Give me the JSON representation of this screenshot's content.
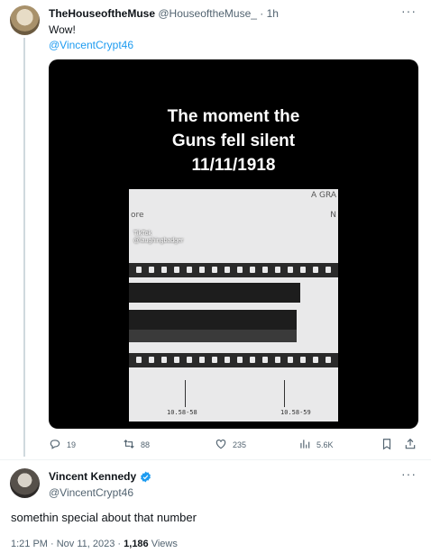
{
  "reply": {
    "display_name": "TheHouseoftheMuse",
    "handle": "@HouseoftheMuse_",
    "time": "· 1h",
    "text": "Wow!",
    "mention": "@VincentCrypt46",
    "media": {
      "caption_line1": "The moment the",
      "caption_line2": "Guns fell silent",
      "caption_line3": "11/11/1918",
      "film_corner_top": "A GRA",
      "film_corner_left": "ore",
      "film_corner_right": "N",
      "watermark_brand": "TikTok",
      "watermark_user": "@laughingbadger",
      "time_label_1": "10.58-58",
      "time_label_2": "10.58-59"
    },
    "actions": {
      "replies": "19",
      "reposts": "88",
      "likes": "235",
      "views": "5.6K"
    }
  },
  "main": {
    "display_name": "Vincent Kennedy",
    "handle": "@VincentCrypt46",
    "text": "somethin special about that number",
    "timestamp": "1:21 PM · Nov 11, 2023 · ",
    "views_count": "1,186",
    "views_label": " Views"
  },
  "icons": {
    "more": "more-icon",
    "reply": "reply-icon",
    "repost": "repost-icon",
    "like": "heart-icon",
    "views": "views-icon",
    "bookmark": "bookmark-icon",
    "share": "share-icon",
    "verified": "verified-badge-icon"
  },
  "colors": {
    "link": "#1d9bf0",
    "secondary_text": "#536471",
    "verified": "#1d9bf0"
  }
}
